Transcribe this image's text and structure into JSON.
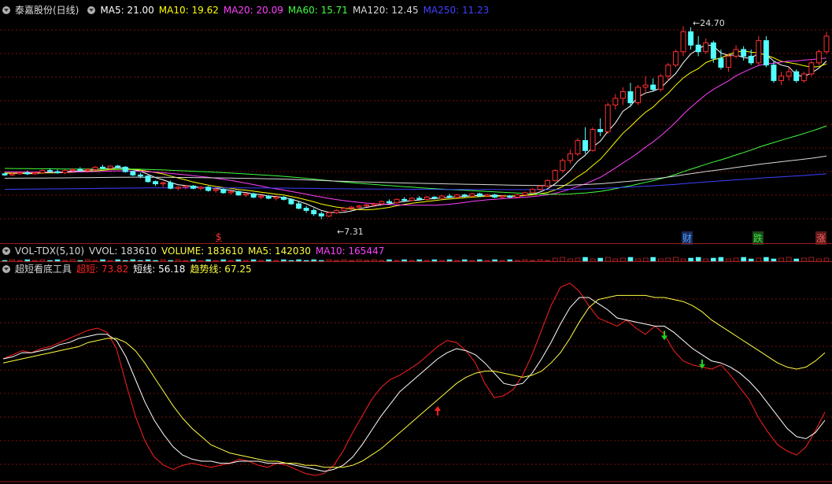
{
  "price_legend": {
    "stock_name": "泰嘉股份(日线)",
    "items": [
      {
        "text": "MA5: 21.00",
        "color": "#ffffff"
      },
      {
        "text": "MA10: 19.62",
        "color": "#ffff00"
      },
      {
        "text": "MA20: 20.09",
        "color": "#ff40ff"
      },
      {
        "text": "MA60: 15.71",
        "color": "#40ff40"
      },
      {
        "text": "MA120: 12.45",
        "color": "#d8d8d8"
      },
      {
        "text": "MA250: 11.23",
        "color": "#4040ff"
      }
    ]
  },
  "volume_legend": {
    "items": [
      {
        "text": "VOL-TDX(5,10)",
        "color": "#d8d8d8"
      },
      {
        "text": "VVOL: 183610",
        "color": "#d8d8d8"
      },
      {
        "text": "VOLUME: 183610",
        "color": "#ffff40"
      },
      {
        "text": "MA5: 142030",
        "color": "#ffff40"
      },
      {
        "text": "MA10: 165447",
        "color": "#ff40ff"
      }
    ]
  },
  "indicator_legend": {
    "name": "超短看底工具",
    "items": [
      {
        "text": "超短: 73.82",
        "color": "#ff2020"
      },
      {
        "text": "短线: 56.18",
        "color": "#ffffff"
      },
      {
        "text": "趋势线: 67.25",
        "color": "#ffff40"
      }
    ]
  },
  "price_annotations": {
    "high": "24.70",
    "low": "7.31"
  },
  "event_markers": [
    {
      "text": "$",
      "color": "#ff3030"
    },
    {
      "text": "财",
      "color": "#4aa3ff"
    },
    {
      "text": "跌",
      "color": "#40e040"
    },
    {
      "text": "涨",
      "color": "#ff5050"
    }
  ],
  "colors": {
    "up": "#ff3030",
    "down": "#54ffff",
    "grid": "#7a1010",
    "border": "#a01818"
  },
  "chart_data": [
    {
      "type": "candlestick",
      "title": "泰嘉股份(日线)",
      "ylim": [
        6.5,
        25.5
      ],
      "ohlc": [
        [
          11.4,
          11.5,
          11.2,
          11.3
        ],
        [
          11.3,
          11.5,
          11.2,
          11.4
        ],
        [
          11.4,
          11.6,
          11.3,
          11.5
        ],
        [
          11.5,
          11.7,
          11.3,
          11.4
        ],
        [
          11.4,
          11.6,
          11.3,
          11.5
        ],
        [
          11.5,
          11.8,
          11.4,
          11.7
        ],
        [
          11.7,
          11.9,
          11.5,
          11.6
        ],
        [
          11.6,
          11.8,
          11.4,
          11.5
        ],
        [
          11.5,
          11.8,
          11.4,
          11.7
        ],
        [
          11.7,
          11.9,
          11.6,
          11.8
        ],
        [
          11.8,
          12.0,
          11.6,
          11.7
        ],
        [
          11.7,
          11.9,
          11.5,
          11.8
        ],
        [
          11.8,
          12.1,
          11.7,
          12.0
        ],
        [
          12.0,
          12.2,
          11.8,
          11.9
        ],
        [
          11.9,
          12.1,
          11.7,
          12.1
        ],
        [
          12.1,
          12.2,
          11.9,
          12.0
        ],
        [
          12.0,
          12.1,
          11.5,
          11.6
        ],
        [
          11.6,
          11.7,
          11.2,
          11.3
        ],
        [
          11.3,
          11.5,
          11.0,
          11.2
        ],
        [
          11.2,
          11.3,
          10.6,
          10.7
        ],
        [
          10.7,
          10.8,
          10.3,
          10.5
        ],
        [
          10.5,
          10.7,
          10.2,
          10.6
        ],
        [
          10.6,
          10.8,
          10.0,
          10.1
        ],
        [
          10.1,
          10.3,
          9.9,
          10.2
        ],
        [
          10.2,
          10.4,
          10.0,
          10.3
        ],
        [
          10.3,
          10.4,
          10.0,
          10.1
        ],
        [
          10.1,
          10.3,
          9.9,
          10.2
        ],
        [
          10.2,
          10.3,
          9.8,
          9.9
        ],
        [
          9.9,
          10.1,
          9.7,
          10.0
        ],
        [
          10.0,
          10.1,
          9.6,
          9.7
        ],
        [
          9.7,
          9.9,
          9.5,
          9.8
        ],
        [
          9.8,
          9.9,
          9.4,
          9.5
        ],
        [
          9.5,
          9.7,
          9.3,
          9.6
        ],
        [
          9.6,
          9.7,
          9.2,
          9.3
        ],
        [
          9.3,
          9.5,
          9.1,
          9.4
        ],
        [
          9.4,
          9.5,
          9.1,
          9.2
        ],
        [
          9.2,
          9.4,
          9.0,
          9.3
        ],
        [
          9.3,
          9.4,
          9.0,
          9.1
        ],
        [
          9.1,
          9.2,
          8.6,
          8.7
        ],
        [
          8.7,
          8.9,
          8.2,
          8.3
        ],
        [
          8.3,
          8.5,
          7.9,
          8.1
        ],
        [
          8.1,
          8.3,
          7.6,
          7.8
        ],
        [
          7.8,
          8.0,
          7.31,
          7.6
        ],
        [
          7.6,
          8.0,
          7.5,
          7.9
        ],
        [
          7.9,
          8.2,
          7.8,
          8.1
        ],
        [
          8.1,
          8.4,
          8.0,
          8.3
        ],
        [
          8.3,
          8.5,
          8.1,
          8.4
        ],
        [
          8.4,
          8.6,
          8.2,
          8.5
        ],
        [
          8.5,
          8.7,
          8.4,
          8.6
        ],
        [
          8.6,
          8.8,
          8.4,
          8.7
        ],
        [
          8.7,
          9.0,
          8.6,
          8.9
        ],
        [
          8.9,
          9.1,
          8.7,
          8.8
        ],
        [
          8.8,
          9.2,
          8.7,
          9.1
        ],
        [
          9.1,
          9.3,
          8.9,
          9.0
        ],
        [
          9.0,
          9.3,
          8.9,
          9.2
        ],
        [
          9.2,
          9.4,
          9.0,
          9.1
        ],
        [
          9.1,
          9.4,
          9.0,
          9.3
        ],
        [
          9.3,
          9.4,
          9.1,
          9.2
        ],
        [
          9.2,
          9.5,
          9.1,
          9.4
        ],
        [
          9.4,
          9.6,
          9.2,
          9.3
        ],
        [
          9.3,
          9.6,
          9.2,
          9.5
        ],
        [
          9.5,
          9.6,
          9.3,
          9.4
        ],
        [
          9.4,
          9.7,
          9.3,
          9.6
        ],
        [
          9.6,
          9.7,
          9.3,
          9.4
        ],
        [
          9.4,
          9.6,
          9.3,
          9.5
        ],
        [
          9.5,
          9.6,
          9.2,
          9.3
        ],
        [
          9.3,
          9.5,
          9.2,
          9.4
        ],
        [
          9.4,
          9.5,
          9.2,
          9.3
        ],
        [
          9.3,
          9.6,
          9.2,
          9.5
        ],
        [
          9.5,
          9.8,
          9.4,
          9.7
        ],
        [
          9.7,
          10.1,
          9.6,
          10.0
        ],
        [
          10.0,
          10.4,
          9.9,
          10.3
        ],
        [
          10.3,
          10.9,
          10.2,
          10.8
        ],
        [
          10.8,
          11.8,
          10.7,
          11.7
        ],
        [
          11.7,
          12.8,
          11.5,
          12.6
        ],
        [
          12.6,
          13.6,
          12.3,
          13.2
        ],
        [
          13.2,
          14.6,
          13.0,
          14.4
        ],
        [
          14.4,
          15.6,
          13.2,
          13.5
        ],
        [
          13.5,
          15.6,
          13.4,
          15.4
        ],
        [
          15.4,
          16.4,
          14.8,
          15.2
        ],
        [
          15.2,
          17.8,
          15.0,
          17.6
        ],
        [
          17.6,
          18.6,
          17.2,
          18.2
        ],
        [
          18.2,
          19.2,
          17.6,
          18.8
        ],
        [
          18.8,
          19.6,
          17.4,
          17.8
        ],
        [
          17.8,
          19.4,
          17.6,
          19.2
        ],
        [
          19.2,
          20.2,
          18.6,
          19.4
        ],
        [
          19.4,
          20.0,
          18.8,
          19.0
        ],
        [
          19.0,
          20.4,
          18.8,
          20.2
        ],
        [
          20.2,
          21.4,
          19.8,
          21.2
        ],
        [
          21.2,
          22.6,
          21.0,
          22.4
        ],
        [
          22.4,
          24.7,
          22.0,
          24.2
        ],
        [
          24.2,
          24.6,
          22.6,
          23.0
        ],
        [
          23.0,
          23.8,
          22.0,
          22.4
        ],
        [
          22.4,
          23.6,
          22.2,
          23.2
        ],
        [
          23.2,
          23.4,
          21.4,
          21.8
        ],
        [
          21.8,
          22.6,
          20.8,
          21.0
        ],
        [
          21.0,
          22.2,
          20.6,
          22.0
        ],
        [
          22.0,
          23.0,
          21.8,
          22.6
        ],
        [
          22.6,
          22.9,
          21.6,
          22.0
        ],
        [
          22.0,
          22.6,
          21.2,
          21.4
        ],
        [
          21.4,
          23.8,
          21.2,
          23.4
        ],
        [
          23.4,
          23.8,
          21.0,
          21.2
        ],
        [
          21.2,
          21.6,
          19.6,
          19.8
        ],
        [
          19.8,
          20.6,
          19.4,
          20.2
        ],
        [
          20.2,
          21.0,
          19.8,
          20.6
        ],
        [
          20.6,
          20.8,
          19.6,
          19.8
        ],
        [
          19.8,
          20.6,
          19.6,
          20.4
        ],
        [
          20.4,
          21.6,
          20.2,
          21.4
        ],
        [
          21.4,
          22.6,
          21.2,
          22.4
        ],
        [
          22.4,
          24.2,
          22.2,
          23.8
        ]
      ]
    },
    {
      "type": "line",
      "title": "超短看底工具",
      "ylim": [
        0,
        100
      ],
      "series": [
        {
          "name": "超短",
          "color": "#ff2020",
          "values": [
            60,
            62,
            64,
            63,
            65,
            66,
            68,
            70,
            72,
            74,
            75,
            73,
            65,
            48,
            32,
            20,
            12,
            8,
            6,
            8,
            9,
            8,
            7,
            8,
            9,
            11,
            10,
            8,
            7,
            9,
            8,
            6,
            4,
            3,
            4,
            8,
            15,
            24,
            32,
            40,
            46,
            50,
            52,
            55,
            58,
            62,
            66,
            69,
            68,
            64,
            58,
            48,
            41,
            42,
            45,
            52,
            62,
            74,
            86,
            95,
            97,
            93,
            86,
            80,
            78,
            76,
            79,
            75,
            72,
            76,
            72,
            64,
            59,
            57,
            56,
            55,
            57,
            52,
            46,
            40,
            31,
            24,
            18,
            15,
            13,
            17,
            25,
            34
          ]
        },
        {
          "name": "短线",
          "color": "#ffffff",
          "values": [
            60,
            61,
            63,
            63,
            64,
            65,
            67,
            68,
            70,
            71,
            72,
            72,
            69,
            61,
            50,
            39,
            30,
            23,
            17,
            13,
            11,
            10,
            10,
            9,
            9,
            10,
            10,
            10,
            9,
            9,
            9,
            8,
            7,
            6,
            5,
            6,
            8,
            12,
            18,
            25,
            32,
            38,
            44,
            48,
            52,
            56,
            60,
            63,
            65,
            64,
            62,
            58,
            53,
            48,
            47,
            48,
            53,
            60,
            68,
            77,
            85,
            90,
            90,
            87,
            84,
            80,
            79,
            78,
            77,
            76,
            76,
            73,
            69,
            65,
            62,
            59,
            58,
            56,
            53,
            49,
            44,
            38,
            32,
            26,
            22,
            21,
            24,
            30
          ]
        },
        {
          "name": "趋势线",
          "color": "#ffff40",
          "values": [
            58,
            59,
            60,
            61,
            62,
            63,
            64,
            65,
            66,
            68,
            69,
            70,
            70,
            68,
            64,
            58,
            51,
            44,
            37,
            31,
            26,
            22,
            18,
            16,
            14,
            13,
            12,
            11,
            10,
            10,
            9,
            9,
            8,
            8,
            7,
            7,
            7,
            8,
            10,
            13,
            16,
            20,
            24,
            28,
            32,
            36,
            40,
            44,
            48,
            51,
            53,
            54,
            54,
            53,
            52,
            51,
            52,
            54,
            58,
            63,
            70,
            78,
            85,
            89,
            90,
            91,
            91,
            91,
            91,
            90,
            90,
            89,
            88,
            86,
            83,
            79,
            76,
            73,
            70,
            67,
            64,
            61,
            58,
            56,
            55,
            56,
            59,
            63
          ]
        }
      ],
      "arrows": [
        {
          "kind": "up",
          "color": "#ff2020",
          "index": 46
        },
        {
          "kind": "down",
          "color": "#20d020",
          "index": 70
        },
        {
          "kind": "down",
          "color": "#20d020",
          "index": 74
        }
      ]
    }
  ]
}
